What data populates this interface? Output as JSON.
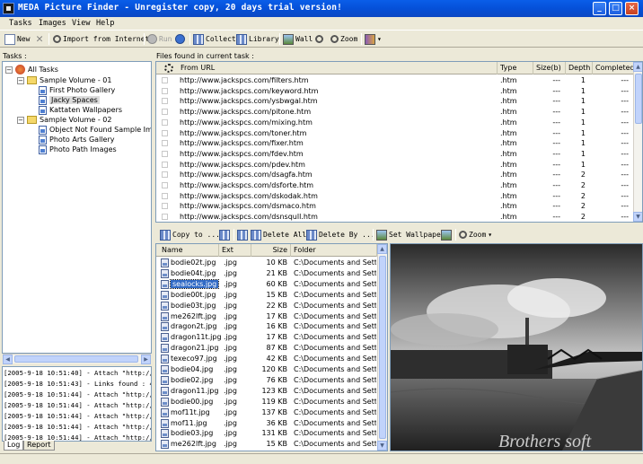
{
  "window": {
    "title": "MEDA Picture Finder - Unregister copy, 20 days trial version!",
    "minimize": "_",
    "maximize": "□",
    "close": "×"
  },
  "menu": [
    "Tasks",
    "Images",
    "View",
    "Help"
  ],
  "toolbar": {
    "new": "New",
    "import": "Import from Internet",
    "run": "Run",
    "collect": "Collect",
    "library": "Library",
    "wall": "Wall",
    "zoom": "Zoom"
  },
  "tasks_label": "Tasks :",
  "files_label": "Files found in current task :",
  "tree": {
    "root": "All Tasks",
    "volumes": [
      {
        "name": "Sample Volume - 01",
        "items": [
          "First Photo Gallery",
          "Jacky Spaces",
          "Kattaten Wallpapers"
        ]
      },
      {
        "name": "Sample Volume - 02",
        "items": [
          "Object Not Found Sample Images",
          "Photo Arts Gallery",
          "Photo Path Images"
        ]
      }
    ]
  },
  "log": [
    "[2005-9-18 10:51:40] - Attach \"http://w",
    "[2005-9-18 10:51:43] - Links found : 49",
    "[2005-9-18 10:51:44] - Attach \"http://w",
    "[2005-9-18 10:51:44] - Attach \"http://w",
    "[2005-9-18 10:51:44] - Attach \"http://w",
    "[2005-9-18 10:51:44] - Attach \"http://w",
    "[2005-9-18 10:51:44] - Attach \"http://w"
  ],
  "log_tabs": [
    "Log",
    "Report"
  ],
  "url_table": {
    "columns": [
      "From URL",
      "Type",
      "Size(b)",
      "Depth",
      "Completed"
    ],
    "rows": [
      [
        "http://www.jackspcs.com/filters.htm",
        ".htm",
        "---",
        "1",
        "---"
      ],
      [
        "http://www.jackspcs.com/keyword.htm",
        ".htm",
        "---",
        "1",
        "---"
      ],
      [
        "http://www.jackspcs.com/ysbwgal.htm",
        ".htm",
        "---",
        "1",
        "---"
      ],
      [
        "http://www.jackspcs.com/pitone.htm",
        ".htm",
        "---",
        "1",
        "---"
      ],
      [
        "http://www.jackspcs.com/mixing.htm",
        ".htm",
        "---",
        "1",
        "---"
      ],
      [
        "http://www.jackspcs.com/toner.htm",
        ".htm",
        "---",
        "1",
        "---"
      ],
      [
        "http://www.jackspcs.com/fixer.htm",
        ".htm",
        "---",
        "1",
        "---"
      ],
      [
        "http://www.jackspcs.com/fdev.htm",
        ".htm",
        "---",
        "1",
        "---"
      ],
      [
        "http://www.jackspcs.com/pdev.htm",
        ".htm",
        "---",
        "1",
        "---"
      ],
      [
        "http://www.jackspcs.com/dsagfa.htm",
        ".htm",
        "---",
        "2",
        "---"
      ],
      [
        "http://www.jackspcs.com/dsforte.htm",
        ".htm",
        "---",
        "2",
        "---"
      ],
      [
        "http://www.jackspcs.com/dskodak.htm",
        ".htm",
        "---",
        "2",
        "---"
      ],
      [
        "http://www.jackspcs.com/dsmaco.htm",
        ".htm",
        "---",
        "2",
        "---"
      ],
      [
        "http://www.jackspcs.com/dsnsqull.htm",
        ".htm",
        "---",
        "2",
        "---"
      ]
    ]
  },
  "toolbar2": {
    "copy_to": "Copy to ...",
    "delete_all": "Delete All",
    "delete_by": "Delete By ...",
    "set_wallpaper": "Set Wallpaper",
    "zoom": "Zoom"
  },
  "file_table": {
    "columns": [
      "Name",
      "Ext",
      "Size",
      "Folder"
    ],
    "selected": "sealocks.jpg",
    "rows": [
      [
        "bodie02t.jpg",
        ".jpg",
        "10 KB",
        "C:\\Documents and Setti..."
      ],
      [
        "bodie04t.jpg",
        ".jpg",
        "21 KB",
        "C:\\Documents and Setti..."
      ],
      [
        "sealocks.jpg",
        ".jpg",
        "60 KB",
        "C:\\Documents and Setti..."
      ],
      [
        "bodie00t.jpg",
        ".jpg",
        "15 KB",
        "C:\\Documents and Setti..."
      ],
      [
        "bodie03t.jpg",
        ".jpg",
        "22 KB",
        "C:\\Documents and Setti..."
      ],
      [
        "me262lft.jpg",
        ".jpg",
        "17 KB",
        "C:\\Documents and Setti..."
      ],
      [
        "dragon2t.jpg",
        ".jpg",
        "16 KB",
        "C:\\Documents and Setti..."
      ],
      [
        "dragon11t.jpg",
        ".jpg",
        "17 KB",
        "C:\\Documents and Setti..."
      ],
      [
        "dragon21.jpg",
        ".jpg",
        "87 KB",
        "C:\\Documents and Setti..."
      ],
      [
        "texeco97.jpg",
        ".jpg",
        "42 KB",
        "C:\\Documents and Setti..."
      ],
      [
        "bodie04.jpg",
        ".jpg",
        "120 KB",
        "C:\\Documents and Setti..."
      ],
      [
        "bodie02.jpg",
        ".jpg",
        "76 KB",
        "C:\\Documents and Setti..."
      ],
      [
        "dragon11.jpg",
        ".jpg",
        "123 KB",
        "C:\\Documents and Setti..."
      ],
      [
        "bodie00.jpg",
        ".jpg",
        "119 KB",
        "C:\\Documents and Setti..."
      ],
      [
        "mof11t.jpg",
        ".jpg",
        "137 KB",
        "C:\\Documents and Setti..."
      ],
      [
        "mof11.jpg",
        ".jpg",
        "36 KB",
        "C:\\Documents and Setti..."
      ],
      [
        "bodie03.jpg",
        ".jpg",
        "131 KB",
        "C:\\Documents and Setti..."
      ],
      [
        "me262lft.jpg",
        ".jpg",
        "15 KB",
        "C:\\Documents and Setti..."
      ]
    ]
  },
  "watermark": "Brothers soft"
}
